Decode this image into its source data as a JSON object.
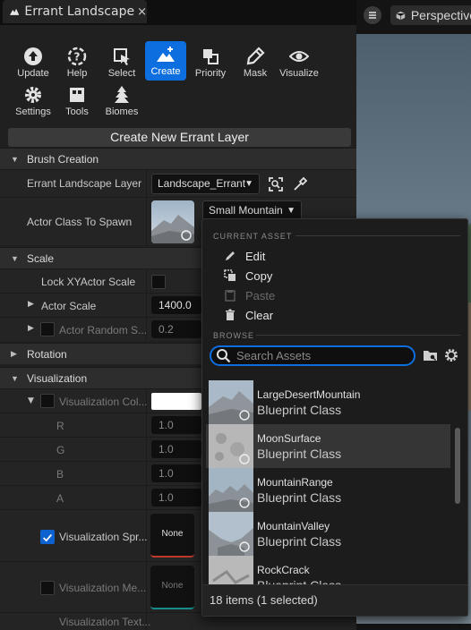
{
  "tab": {
    "title": "Errant Landscape",
    "close": "×"
  },
  "toolbar": {
    "row1": [
      {
        "label": "Update",
        "icon": "update-icon"
      },
      {
        "label": "Help",
        "icon": "help-icon"
      },
      {
        "label": "Select",
        "icon": "select-icon"
      },
      {
        "label": "Create",
        "icon": "create-icon",
        "active": true
      },
      {
        "label": "Priority",
        "icon": "priority-icon"
      },
      {
        "label": "Mask",
        "icon": "mask-icon"
      },
      {
        "label": "Visualize",
        "icon": "visualize-icon"
      }
    ],
    "row2": [
      {
        "label": "Settings",
        "icon": "settings-icon"
      },
      {
        "label": "Tools",
        "icon": "tools-icon"
      },
      {
        "label": "Biomes",
        "icon": "biomes-icon"
      }
    ]
  },
  "create_button": "Create New Errant Layer",
  "brush_creation": {
    "title": "Brush Creation",
    "layer_label": "Errant Landscape Layer",
    "layer_value": "Landscape_Errant",
    "actor_class_label": "Actor Class To Spawn",
    "actor_class_value": "Small Mountain"
  },
  "scale": {
    "title": "Scale",
    "lock_label": "Lock XYActor Scale",
    "actor_scale_label": "Actor Scale",
    "actor_scale_value": "1400.0",
    "random_label": "Actor Random S...",
    "random_value": "0.2"
  },
  "rotation": {
    "title": "Rotation"
  },
  "visualization": {
    "title": "Visualization",
    "color_label": "Visualization Col...",
    "channels": [
      {
        "label": "R",
        "value": "1.0"
      },
      {
        "label": "G",
        "value": "1.0"
      },
      {
        "label": "B",
        "value": "1.0"
      },
      {
        "label": "A",
        "value": "1.0"
      }
    ],
    "sprite_label": "Visualization Spr...",
    "sprite_value": "None",
    "mesh_label": "Visualization Me...",
    "mesh_value": "None",
    "last_label": "Visualization Text..."
  },
  "viewport": {
    "perspective": "Perspective"
  },
  "dropdown": {
    "current_asset": "CURRENT ASSET",
    "edit": "Edit",
    "copy": "Copy",
    "paste": "Paste",
    "clear": "Clear",
    "browse": "BROWSE",
    "search_placeholder": "Search Assets",
    "assets": [
      {
        "name": "LargeDesertMountain",
        "type": "Blueprint Class"
      },
      {
        "name": "MoonSurface",
        "type": "Blueprint Class",
        "selected": true
      },
      {
        "name": "MountainRange",
        "type": "Blueprint Class"
      },
      {
        "name": "MountainValley",
        "type": "Blueprint Class"
      },
      {
        "name": "RockCrack",
        "type": "Blueprint Class"
      }
    ],
    "footer": "18 items (1 selected)"
  },
  "colors": {
    "accent": "#0d6fdf",
    "panel": "#202020",
    "selected_row": "#353535"
  }
}
